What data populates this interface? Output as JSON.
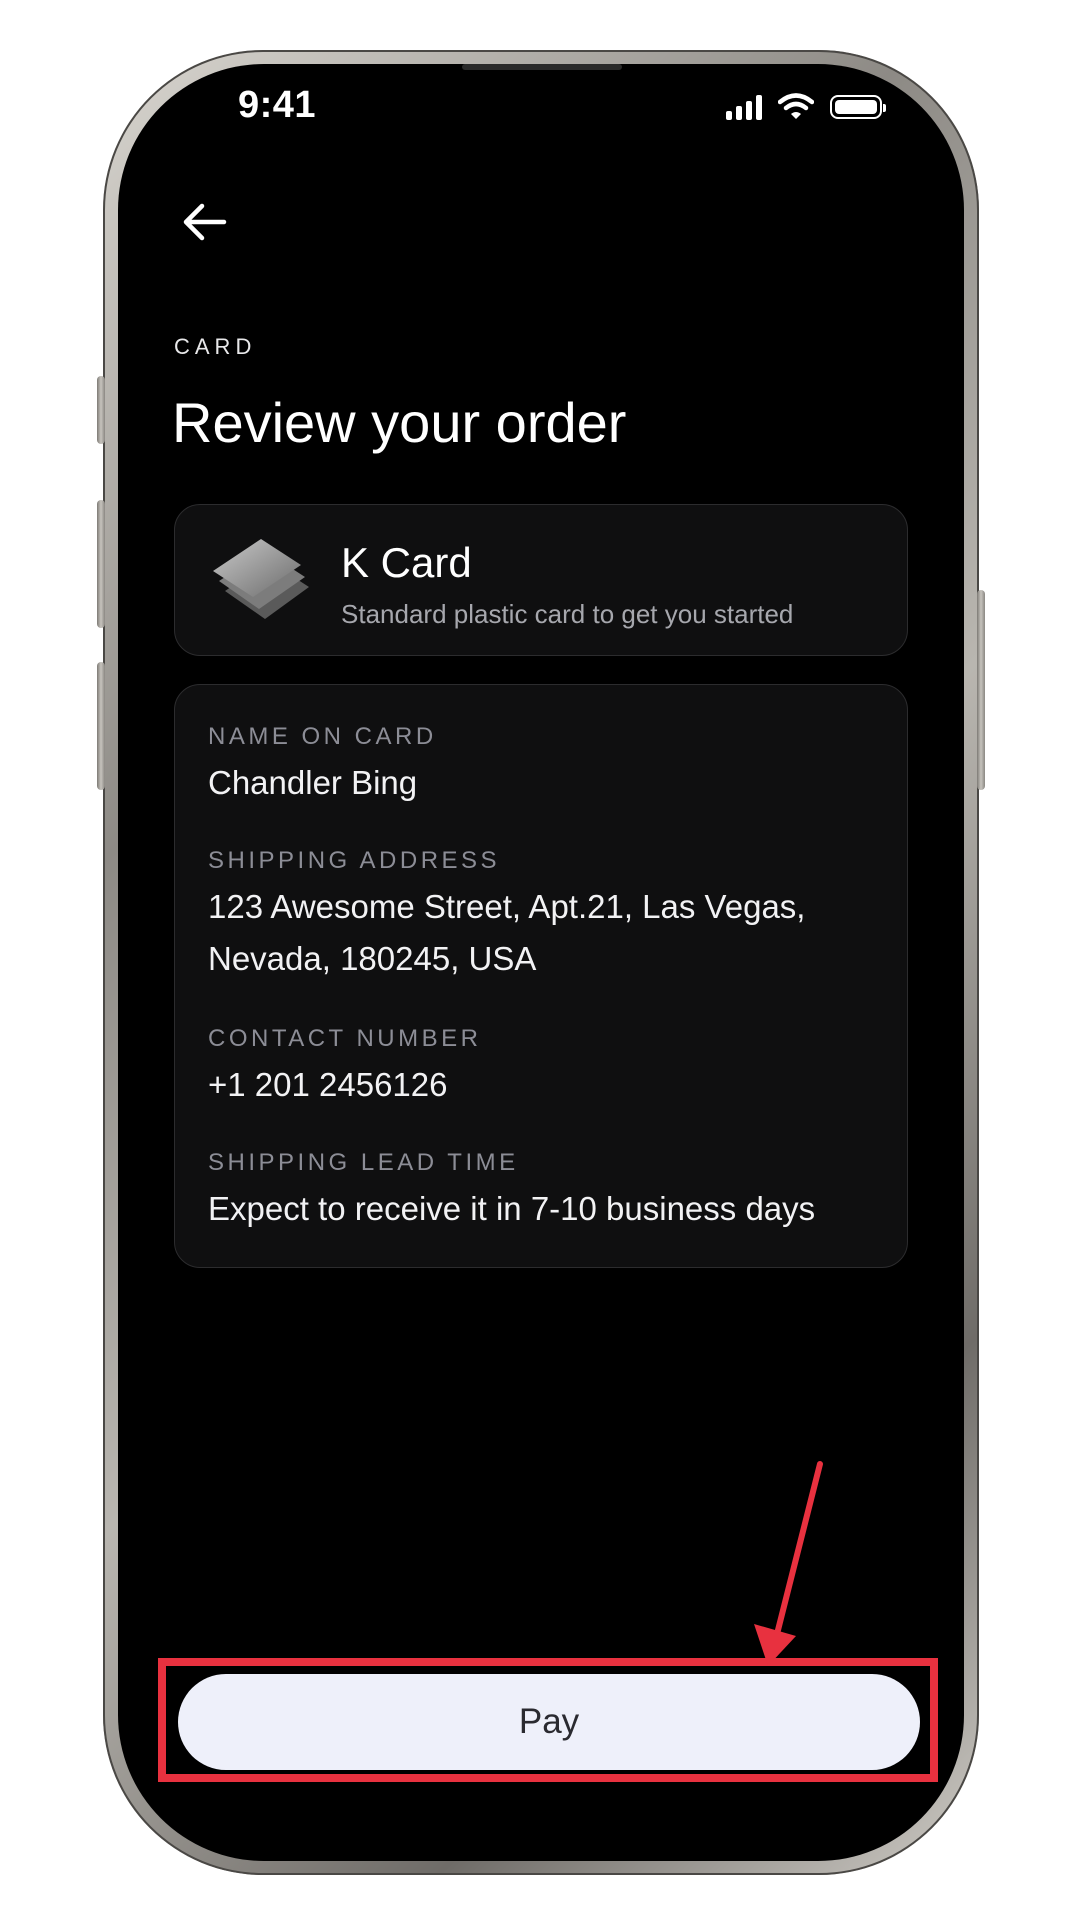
{
  "status_bar": {
    "time": "9:41",
    "signal_icon": "cellular-signal-icon",
    "wifi_icon": "wifi-icon",
    "battery_icon": "battery-icon"
  },
  "nav": {
    "back_icon": "arrow-left-icon"
  },
  "header": {
    "eyebrow": "CARD",
    "title": "Review your order"
  },
  "product": {
    "icon": "stacked-cards-icon",
    "name": "K Card",
    "description": "Standard plastic card to get you started"
  },
  "details": {
    "name_label": "NAME ON CARD",
    "name_value": "Chandler Bing",
    "address_label": "SHIPPING ADDRESS",
    "address_line1": "123 Awesome Street, Apt.21, Las Vegas,",
    "address_line2": "Nevada, 180245, USA",
    "contact_label": "CONTACT NUMBER",
    "contact_value": "+1 201 2456126",
    "lead_label": "SHIPPING LEAD TIME",
    "lead_value": "Expect to receive it in 7-10 business days"
  },
  "actions": {
    "pay_label": "Pay"
  },
  "annotation": {
    "highlight_color": "#e8313f"
  },
  "colors": {
    "background": "#000000",
    "panel": "#0f0f10",
    "label": "#8c8d96",
    "button": "#eef0fa"
  }
}
